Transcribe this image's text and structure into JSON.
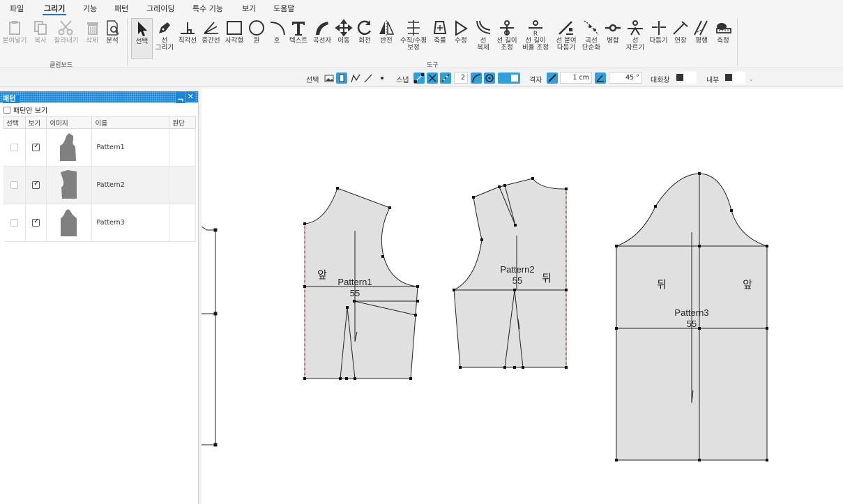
{
  "menu": [
    "파일",
    "그리기",
    "기능",
    "패턴",
    "그레이딩",
    "특수 기능",
    "보기",
    "도움말"
  ],
  "clipboard": {
    "group_label": "클립보드",
    "tools": [
      {
        "label": "붙여넣기",
        "icon": "paste-icon",
        "disabled": true
      },
      {
        "label": "복사",
        "icon": "copy-icon",
        "disabled": true
      },
      {
        "label": "잘라내기",
        "icon": "scissors-icon",
        "disabled": true
      },
      {
        "label": "삭제",
        "icon": "trash-icon",
        "disabled": true
      },
      {
        "label": "분석",
        "icon": "analyze-icon",
        "disabled": false
      }
    ]
  },
  "tools": {
    "group_label": "도구",
    "items": [
      {
        "label": "선택",
        "icon": "select-arrow-icon"
      },
      {
        "label": "선\n그리기",
        "icon": "pen-icon"
      },
      {
        "label": "직각선",
        "icon": "perpendicular-icon"
      },
      {
        "label": "중간선",
        "icon": "angle-bisector-icon"
      },
      {
        "label": "사각형",
        "icon": "rectangle-icon"
      },
      {
        "label": "원",
        "icon": "circle-icon"
      },
      {
        "label": "호",
        "icon": "arc-icon"
      },
      {
        "label": "텍스트",
        "icon": "text-icon"
      },
      {
        "label": "곡선자",
        "icon": "french-curve-icon"
      },
      {
        "label": "이동",
        "icon": "move-icon"
      },
      {
        "label": "회전",
        "icon": "rotate-icon"
      },
      {
        "label": "반전",
        "icon": "mirror-icon"
      },
      {
        "label": "수직/수평\n보정",
        "icon": "align-icon"
      },
      {
        "label": "축률",
        "icon": "shrink-icon"
      },
      {
        "label": "수정",
        "icon": "edit-point-icon"
      },
      {
        "label": "선\n복제",
        "icon": "offset-line-icon"
      },
      {
        "label": "선 길이\n조정",
        "icon": "line-length-icon"
      },
      {
        "label": "선 길이\n비율 조정",
        "icon": "ratio-length-icon"
      },
      {
        "label": "선 붙여\n다듬기",
        "icon": "join-trim-icon"
      },
      {
        "label": "곡선\n단순화",
        "icon": "simplify-curve-icon"
      },
      {
        "label": "병합",
        "icon": "merge-icon"
      },
      {
        "label": "선\n자르기",
        "icon": "cut-line-icon"
      },
      {
        "label": "다듬기",
        "icon": "trim-icon"
      },
      {
        "label": "연장",
        "icon": "extend-icon"
      },
      {
        "label": "평행",
        "icon": "parallel-icon"
      },
      {
        "label": "측정",
        "icon": "tape-measure-icon"
      }
    ]
  },
  "options": {
    "select_label": "선택",
    "snap_label": "스냅",
    "snap_count": "2",
    "grid_label": "격자",
    "grid_value": "1 cm",
    "angle_value": "45 °",
    "dialog_label": "대화창",
    "inner_label": "내부"
  },
  "panel": {
    "title": "패턴",
    "pin": "ᆨ",
    "close": "✕",
    "only_patterns": "패턴만 보기",
    "columns": [
      "선택",
      "보기",
      "이미지",
      "이름",
      "원단"
    ],
    "rows": [
      {
        "name": "Pattern1",
        "selected": false,
        "visible": true,
        "fabric": ""
      },
      {
        "name": "Pattern2",
        "selected": false,
        "visible": true,
        "fabric": ""
      },
      {
        "name": "Pattern3",
        "selected": false,
        "visible": true,
        "fabric": ""
      }
    ]
  },
  "canvas": {
    "pattern1": {
      "name": "Pattern1",
      "qty": "55",
      "side": "앞"
    },
    "pattern2": {
      "name": "Pattern2",
      "qty": "55",
      "side": "뒤"
    },
    "pattern3": {
      "name": "Pattern3",
      "qty": "55",
      "side_left": "뒤",
      "side_right": "앞"
    }
  },
  "colors": {
    "accent": "#1a86d6",
    "toggle_on": "#2fa0dc",
    "piece_fill": "#e0e0e0",
    "grain_line": "#e06666"
  }
}
